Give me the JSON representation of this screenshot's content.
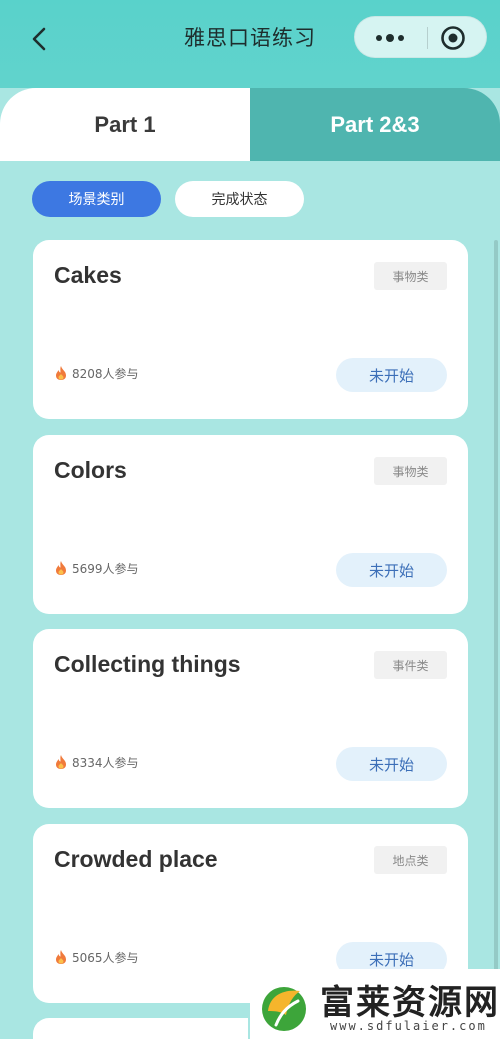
{
  "header": {
    "title": "雅思口语练习"
  },
  "tabs": [
    {
      "label": "Part 1",
      "active": true
    },
    {
      "label": "Part 2&3",
      "active": false
    }
  ],
  "filters": {
    "scene": "场景类别",
    "status": "完成状态"
  },
  "cards": [
    {
      "title": "Cakes",
      "tag": "事物类",
      "participants": "8208人参与",
      "status": "未开始"
    },
    {
      "title": "Colors",
      "tag": "事物类",
      "participants": "5699人参与",
      "status": "未开始"
    },
    {
      "title": "Collecting things",
      "tag": "事件类",
      "participants": "8334人参与",
      "status": "未开始"
    },
    {
      "title": "Crowded place",
      "tag": "地点类",
      "participants": "5065人参与",
      "status": "未开始"
    }
  ],
  "watermark": {
    "name": "富莱资源网",
    "url": "www.sdfulaier.com"
  },
  "colors": {
    "header": "#5dd2cb",
    "background": "#a9e6e2",
    "active_chip": "#3d78e2",
    "tab_inactive": "#4fb5af",
    "status_pill": "#e3f1fb"
  }
}
